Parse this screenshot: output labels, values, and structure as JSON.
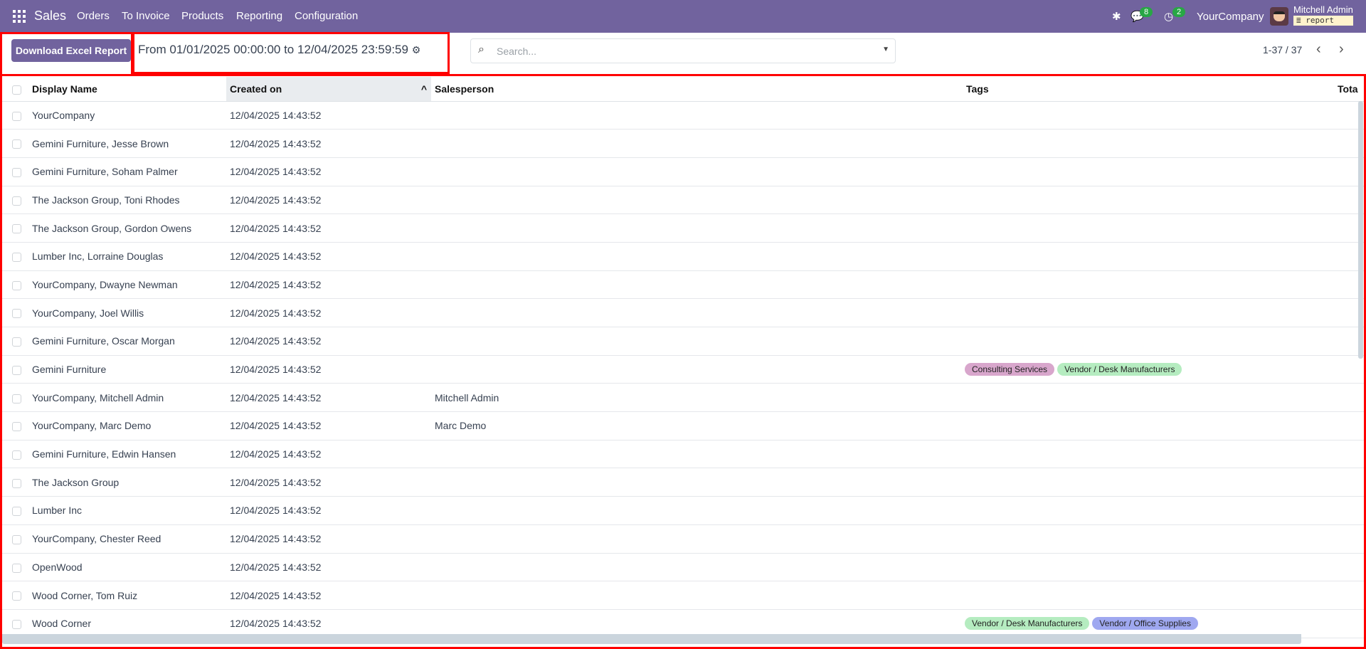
{
  "nav": {
    "app": "Sales",
    "menu": [
      "Orders",
      "To Invoice",
      "Products",
      "Reporting",
      "Configuration"
    ],
    "messages_count": "8",
    "activities_count": "2",
    "company": "YourCompany",
    "user": "Mitchell Admin",
    "database": "report"
  },
  "control": {
    "download_label": "Download Excel Report",
    "date_range": "From 01/01/2025 00:00:00 to 12/04/2025 23:59:59",
    "search_placeholder": "Search...",
    "pager": "1-37 / 37"
  },
  "table": {
    "headers": [
      "Display Name",
      "Created on",
      "Salesperson",
      "Tags",
      "Tota"
    ],
    "rows": [
      {
        "name": "YourCompany",
        "created": "12/04/2025 14:43:52",
        "salesperson": "",
        "tags": []
      },
      {
        "name": "Gemini Furniture, Jesse Brown",
        "created": "12/04/2025 14:43:52",
        "salesperson": "",
        "tags": []
      },
      {
        "name": "Gemini Furniture, Soham Palmer",
        "created": "12/04/2025 14:43:52",
        "salesperson": "",
        "tags": []
      },
      {
        "name": "The Jackson Group, Toni Rhodes",
        "created": "12/04/2025 14:43:52",
        "salesperson": "",
        "tags": []
      },
      {
        "name": "The Jackson Group, Gordon Owens",
        "created": "12/04/2025 14:43:52",
        "salesperson": "",
        "tags": []
      },
      {
        "name": "Lumber Inc, Lorraine Douglas",
        "created": "12/04/2025 14:43:52",
        "salesperson": "",
        "tags": []
      },
      {
        "name": "YourCompany, Dwayne Newman",
        "created": "12/04/2025 14:43:52",
        "salesperson": "",
        "tags": []
      },
      {
        "name": "YourCompany, Joel Willis",
        "created": "12/04/2025 14:43:52",
        "salesperson": "",
        "tags": []
      },
      {
        "name": "Gemini Furniture, Oscar Morgan",
        "created": "12/04/2025 14:43:52",
        "salesperson": "",
        "tags": []
      },
      {
        "name": "Gemini Furniture",
        "created": "12/04/2025 14:43:52",
        "salesperson": "",
        "tags": [
          {
            "label": "Consulting Services",
            "color": "#d8a6cc"
          },
          {
            "label": "Vendor / Desk Manufacturers",
            "color": "#b5ecc0"
          }
        ]
      },
      {
        "name": "YourCompany, Mitchell Admin",
        "created": "12/04/2025 14:43:52",
        "salesperson": "Mitchell Admin",
        "tags": []
      },
      {
        "name": "YourCompany, Marc Demo",
        "created": "12/04/2025 14:43:52",
        "salesperson": "Marc Demo",
        "tags": []
      },
      {
        "name": "Gemini Furniture, Edwin Hansen",
        "created": "12/04/2025 14:43:52",
        "salesperson": "",
        "tags": []
      },
      {
        "name": "The Jackson Group",
        "created": "12/04/2025 14:43:52",
        "salesperson": "",
        "tags": []
      },
      {
        "name": "Lumber Inc",
        "created": "12/04/2025 14:43:52",
        "salesperson": "",
        "tags": []
      },
      {
        "name": "YourCompany, Chester Reed",
        "created": "12/04/2025 14:43:52",
        "salesperson": "",
        "tags": []
      },
      {
        "name": "OpenWood",
        "created": "12/04/2025 14:43:52",
        "salesperson": "",
        "tags": []
      },
      {
        "name": "Wood Corner, Tom Ruiz",
        "created": "12/04/2025 14:43:52",
        "salesperson": "",
        "tags": []
      },
      {
        "name": "Wood Corner",
        "created": "12/04/2025 14:43:52",
        "salesperson": "",
        "tags": [
          {
            "label": "Vendor / Desk Manufacturers",
            "color": "#b5ecc0"
          },
          {
            "label": "Vendor / Office Supplies",
            "color": "#9fa8f0"
          }
        ]
      }
    ]
  }
}
